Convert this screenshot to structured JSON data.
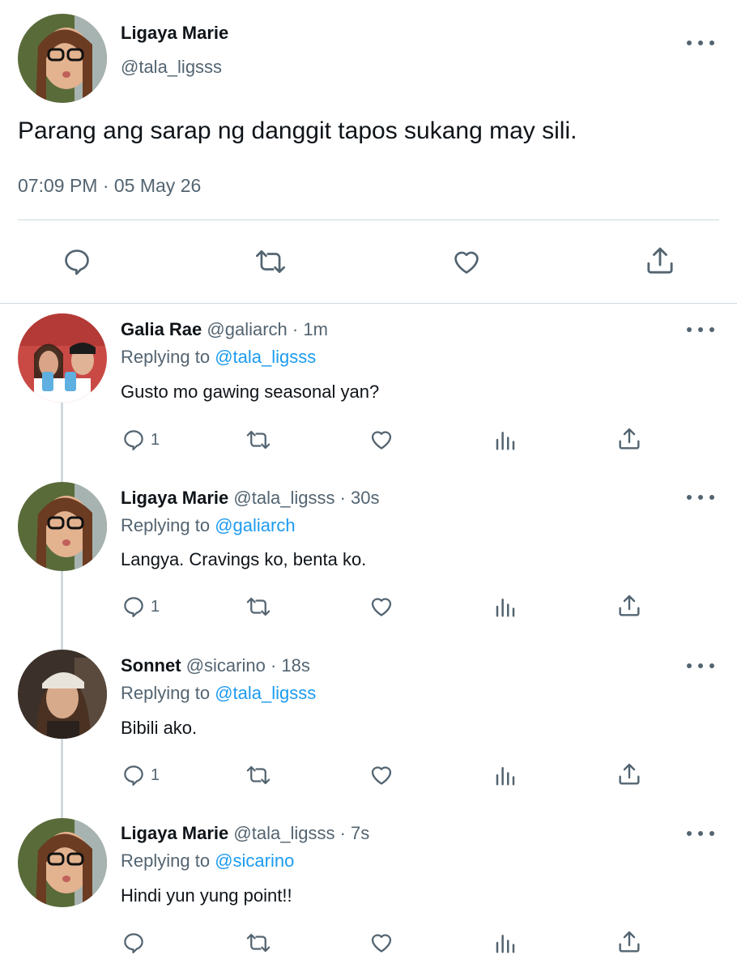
{
  "main_tweet": {
    "name": "Ligaya Marie",
    "handle": "@tala_ligsss",
    "text": "Parang ang sarap ng danggit tapos sukang may sili.",
    "timestamp": "07:09 PM · 05 May 26"
  },
  "replies": [
    {
      "name": "Galia Rae",
      "handle_time": "@galiarch · 1m",
      "replying_prefix": "Replying to",
      "replying_to": "@tala_ligsss",
      "text": "Gusto mo gawing seasonal yan?",
      "reply_count": "1"
    },
    {
      "name": "Ligaya Marie",
      "handle_time": "@tala_ligsss · 30s",
      "replying_prefix": "Replying to",
      "replying_to": "@galiarch",
      "text": "Langya. Cravings ko, benta ko.",
      "reply_count": "1"
    },
    {
      "name": "Sonnet",
      "handle_time": "@sicarino · 18s",
      "replying_prefix": "Replying to",
      "replying_to": "@tala_ligsss",
      "text": "Bibili ako.",
      "reply_count": "1"
    },
    {
      "name": "Ligaya Marie",
      "handle_time": "@tala_ligsss · 7s",
      "replying_prefix": "Replying to",
      "replying_to": "@sicarino",
      "text": "Hindi yun yung point!!",
      "reply_count": ""
    }
  ],
  "colors": {
    "accent": "#1d9bf0",
    "text": "#0f1419",
    "secondary": "#536471",
    "divider": "#cfd9de"
  }
}
